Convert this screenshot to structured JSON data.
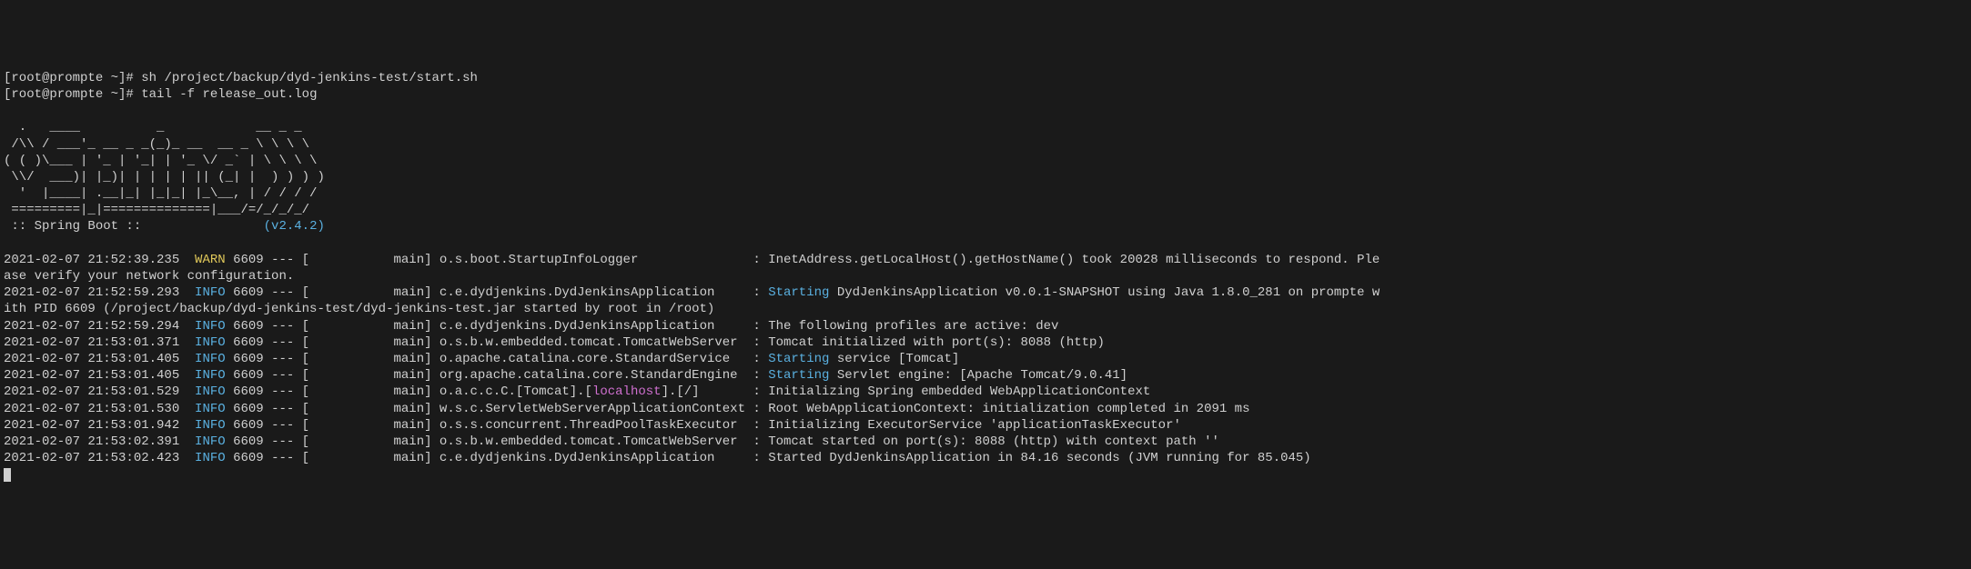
{
  "prompt1": {
    "prefix": "[root@prompte ~]# ",
    "cmd": "sh /project/backup/dyd-jenkins-test/start.sh"
  },
  "prompt2": {
    "prefix": "[root@prompte ~]# ",
    "cmd_pre": "tail ",
    "flag": "-f",
    "cmd_post": " release_out.log"
  },
  "ascii": {
    "l1": "  .   ____          _            __ _ _",
    "l2": " /\\\\ / ___'_ __ _ _(_)_ __  __ _ \\ \\ \\ \\",
    "l3a": "( ( )\\___ | '_ | '_| | '_ \\/ _` | \\ \\ \\ \\",
    "l4": " \\\\/  ___)| |_)| | | | | || (_| |  ) ) ) )",
    "l5": "  '  |____| .__|_| |_|_| |_\\__, | / / / /",
    "l6": " =========|_|==============|___/=/_/_/_/",
    "l7a": " :: Spring Boot ::                ",
    "l7b": "(v2.4.2)"
  },
  "logs": [
    {
      "ts": "2021-02-07 21:52:39.235",
      "lvl": "WARN",
      "lvlcls": "warn",
      "pid": "6609",
      "thread": "main",
      "logger": "o.s.boot.StartupInfoLogger              ",
      "msg_pre": "",
      "starting": "",
      "msg_post": "InetAddress.getLocalHost().getHostName() took 20028 milliseconds to respond. Ple",
      "wrap": "ase verify your network configuration."
    },
    {
      "ts": "2021-02-07 21:52:59.293",
      "lvl": "INFO",
      "lvlcls": "info",
      "pid": "6609",
      "thread": "main",
      "logger": "c.e.dydjenkins.DydJenkinsApplication    ",
      "msg_pre": "",
      "starting": "Starting",
      "msg_post": " DydJenkinsApplication v0.0.1-SNAPSHOT using Java 1.8.0_281 on prompte w",
      "wrap": "ith PID 6609 (/project/backup/dyd-jenkins-test/dyd-jenkins-test.jar started by root in /root)"
    },
    {
      "ts": "2021-02-07 21:52:59.294",
      "lvl": "INFO",
      "lvlcls": "info",
      "pid": "6609",
      "thread": "main",
      "logger": "c.e.dydjenkins.DydJenkinsApplication    ",
      "msg_pre": "",
      "starting": "",
      "msg_post": "The following profiles are active: dev",
      "wrap": ""
    },
    {
      "ts": "2021-02-07 21:53:01.371",
      "lvl": "INFO",
      "lvlcls": "info",
      "pid": "6609",
      "thread": "main",
      "logger": "o.s.b.w.embedded.tomcat.TomcatWebServer ",
      "msg_pre": "",
      "starting": "",
      "msg_post": "Tomcat initialized with port(s): 8088 (http)",
      "wrap": ""
    },
    {
      "ts": "2021-02-07 21:53:01.405",
      "lvl": "INFO",
      "lvlcls": "info",
      "pid": "6609",
      "thread": "main",
      "logger": "o.apache.catalina.core.StandardService  ",
      "msg_pre": "",
      "starting": "Starting",
      "msg_post": " service [Tomcat]",
      "wrap": ""
    },
    {
      "ts": "2021-02-07 21:53:01.405",
      "lvl": "INFO",
      "lvlcls": "info",
      "pid": "6609",
      "thread": "main",
      "logger": "org.apache.catalina.core.StandardEngine ",
      "msg_pre": "",
      "starting": "Starting",
      "msg_post": " Servlet engine: [Apache Tomcat/9.0.41]",
      "wrap": ""
    },
    {
      "ts": "2021-02-07 21:53:01.529",
      "lvl": "INFO",
      "lvlcls": "info",
      "pid": "6609",
      "thread": "main",
      "logger_pre": "o.a.c.c.C.[Tomcat].[",
      "logger_local": "localhost",
      "logger_post": "].[/]      ",
      "msg_pre": "",
      "starting": "",
      "msg_post": "Initializing Spring embedded WebApplicationContext",
      "wrap": "",
      "special": true
    },
    {
      "ts": "2021-02-07 21:53:01.530",
      "lvl": "INFO",
      "lvlcls": "info",
      "pid": "6609",
      "thread": "main",
      "logger": "w.s.c.ServletWebServerApplicationContext",
      "msg_pre": "",
      "starting": "",
      "msg_post": "Root WebApplicationContext: initialization completed in 2091 ms",
      "wrap": ""
    },
    {
      "ts": "2021-02-07 21:53:01.942",
      "lvl": "INFO",
      "lvlcls": "info",
      "pid": "6609",
      "thread": "main",
      "logger": "o.s.s.concurrent.ThreadPoolTaskExecutor ",
      "msg_pre": "",
      "starting": "",
      "msg_post": "Initializing ExecutorService 'applicationTaskExecutor'",
      "wrap": ""
    },
    {
      "ts": "2021-02-07 21:53:02.391",
      "lvl": "INFO",
      "lvlcls": "info",
      "pid": "6609",
      "thread": "main",
      "logger": "o.s.b.w.embedded.tomcat.TomcatWebServer ",
      "msg_pre": "",
      "starting": "",
      "msg_post": "Tomcat started on port(s): 8088 (http) with context path ''",
      "wrap": ""
    },
    {
      "ts": "2021-02-07 21:53:02.423",
      "lvl": "INFO",
      "lvlcls": "info",
      "pid": "6609",
      "thread": "main",
      "logger": "c.e.dydjenkins.DydJenkinsApplication    ",
      "msg_pre": "",
      "starting": "",
      "msg_post": "Started DydJenkinsApplication in 84.16 seconds (JVM running for 85.045)",
      "wrap": ""
    }
  ]
}
